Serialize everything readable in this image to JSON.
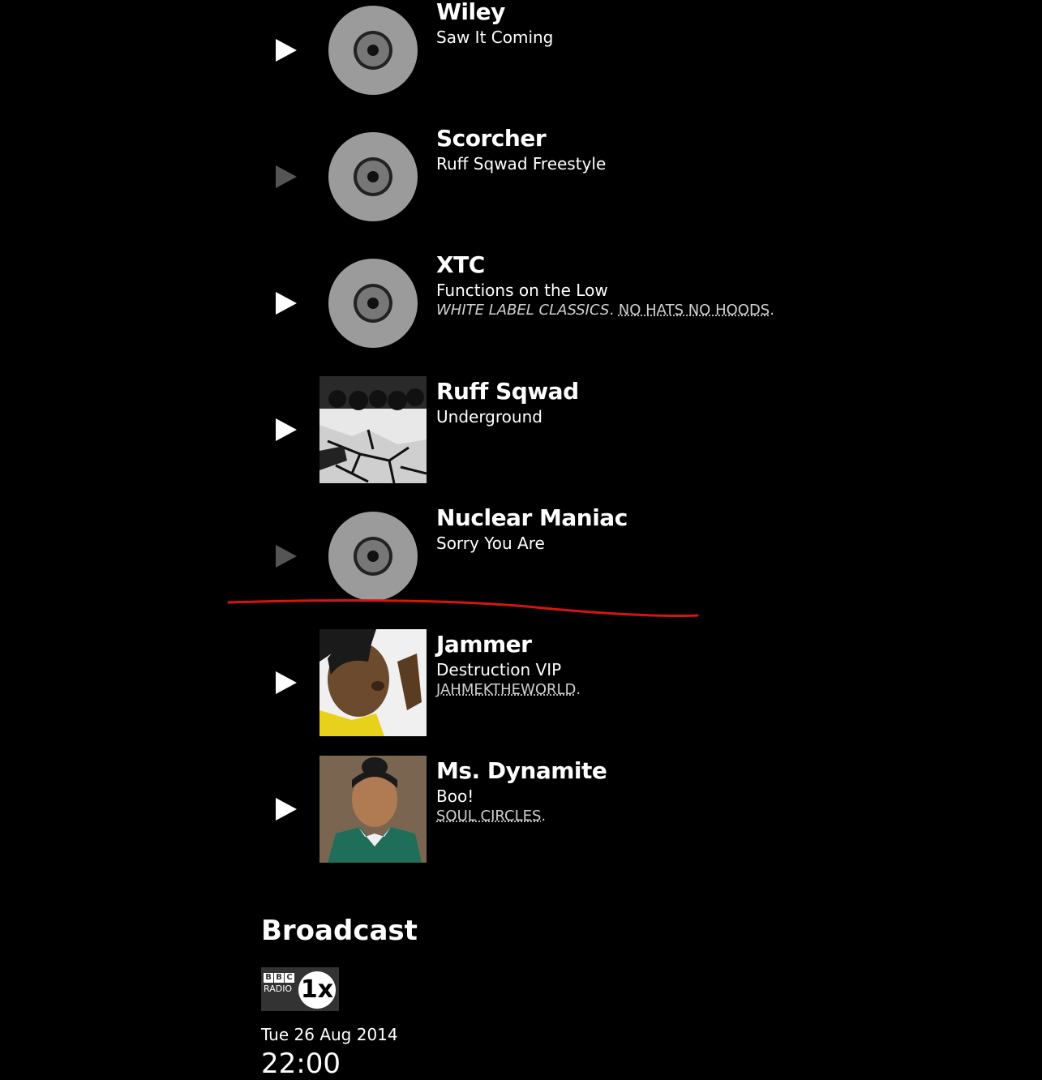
{
  "tracks": [
    {
      "artist": "Wiley",
      "title": "Saw It Coming",
      "play_enabled": true,
      "art": "disc-icon",
      "meta": []
    },
    {
      "artist": "Scorcher",
      "title": "Ruff Sqwad Freestyle",
      "play_enabled": false,
      "art": "disc-icon",
      "meta": []
    },
    {
      "artist": "XTC",
      "title": "Functions on the Low",
      "play_enabled": true,
      "art": "disc-icon",
      "meta": [
        {
          "text": "WHITE LABEL CLASSICS",
          "style": "italic"
        },
        {
          "text": "NO HATS NO HOODS",
          "style": "link"
        }
      ]
    },
    {
      "artist": "Ruff Sqwad",
      "title": "Underground",
      "play_enabled": true,
      "art": "album-cover",
      "meta": []
    },
    {
      "artist": "Nuclear Maniac",
      "title": "Sorry You Are",
      "play_enabled": false,
      "art": "disc-icon",
      "meta": []
    },
    {
      "artist": "Jammer",
      "title": "Destruction VIP",
      "play_enabled": true,
      "art": "artist-photo",
      "meta": [
        {
          "text": "JAHMEKTHEWORLD",
          "style": "link"
        }
      ]
    },
    {
      "artist": "Ms. Dynamite",
      "title": "Boo!",
      "play_enabled": true,
      "art": "artist-photo",
      "meta": [
        {
          "text": "SOUL CIRCLES",
          "style": "link"
        }
      ]
    }
  ],
  "broadcast": {
    "heading": "Broadcast",
    "station_logo": {
      "bbc": [
        "B",
        "B",
        "C"
      ],
      "radio": "RADIO",
      "number": "1x"
    },
    "date": "Tue 26 Aug 2014",
    "time": "22:00"
  },
  "colors": {
    "background": "#000000",
    "text": "#ffffff",
    "play_disabled": "#555555",
    "disc": "#9b9b9b",
    "annotation_line": "#d71414"
  }
}
